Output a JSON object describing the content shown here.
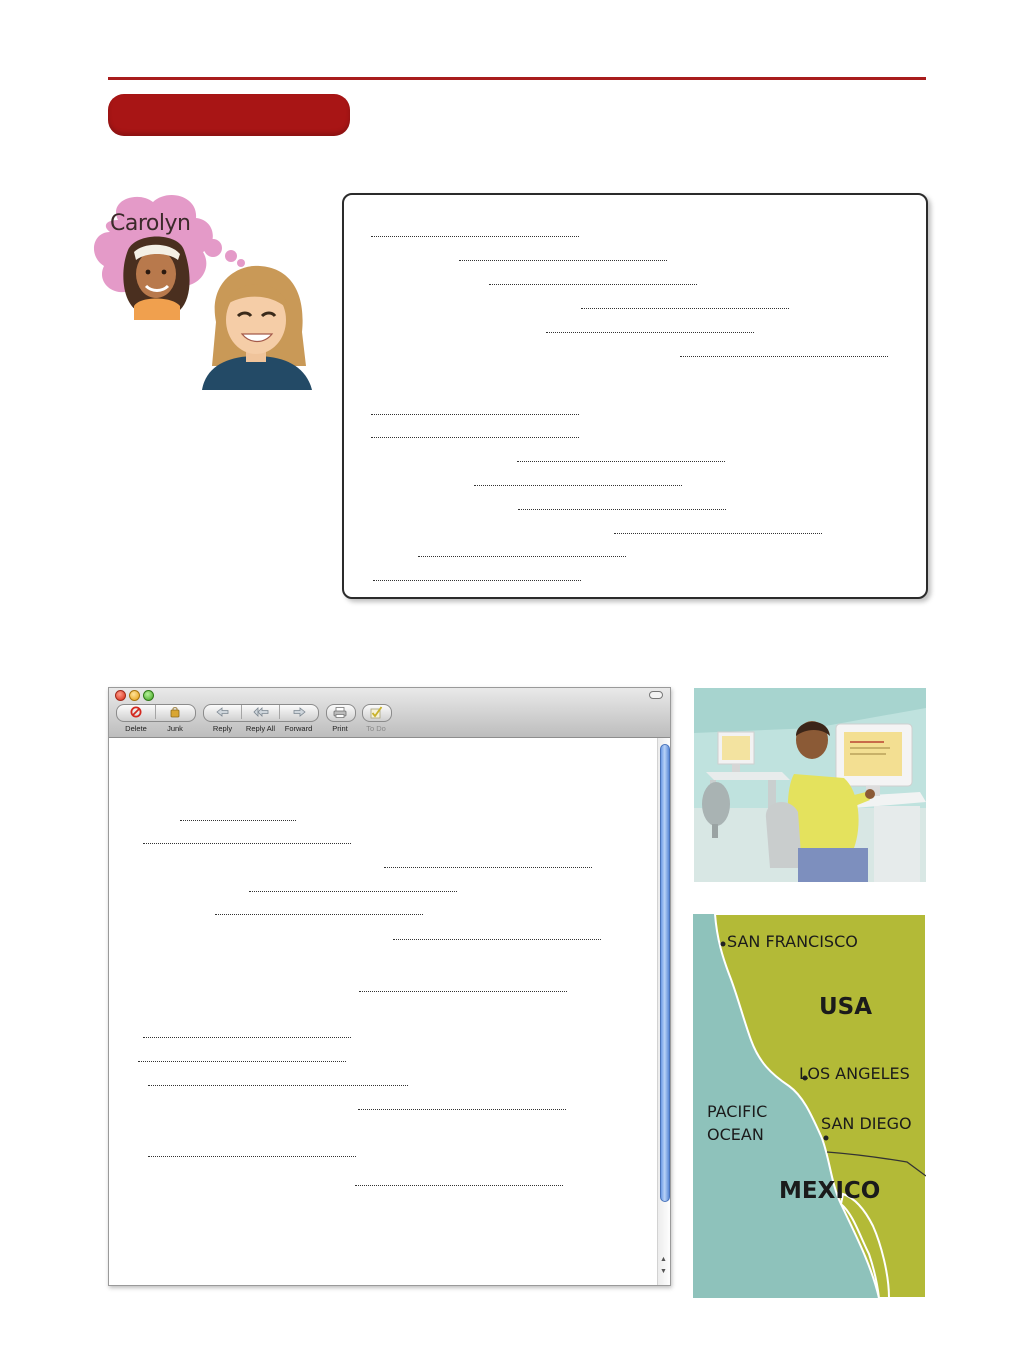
{
  "section": {
    "header_color": "#a81515"
  },
  "characters": {
    "thought_name": "Carolyn"
  },
  "mail": {
    "toolbar": {
      "delete_label": "Delete",
      "junk_label": "Junk",
      "reply_label": "Reply",
      "reply_all_label": "Reply All",
      "forward_label": "Forward",
      "print_label": "Print",
      "todo_label": "To Do"
    },
    "icons": [
      "delete-icon",
      "junk-icon",
      "reply-icon",
      "reply-all-icon",
      "forward-icon",
      "print-icon",
      "todo-icon"
    ]
  },
  "map": {
    "labels": {
      "san_francisco": "SAN FRANCISCO",
      "usa": "USA",
      "los_angeles": "LOS ANGELES",
      "pacific": "PACIFIC",
      "ocean": "OCEAN",
      "san_diego": "SAN DIEGO",
      "mexico": "MEXICO"
    },
    "colors": {
      "land": "#b3ba37",
      "sea": "#8ec2bb"
    }
  }
}
